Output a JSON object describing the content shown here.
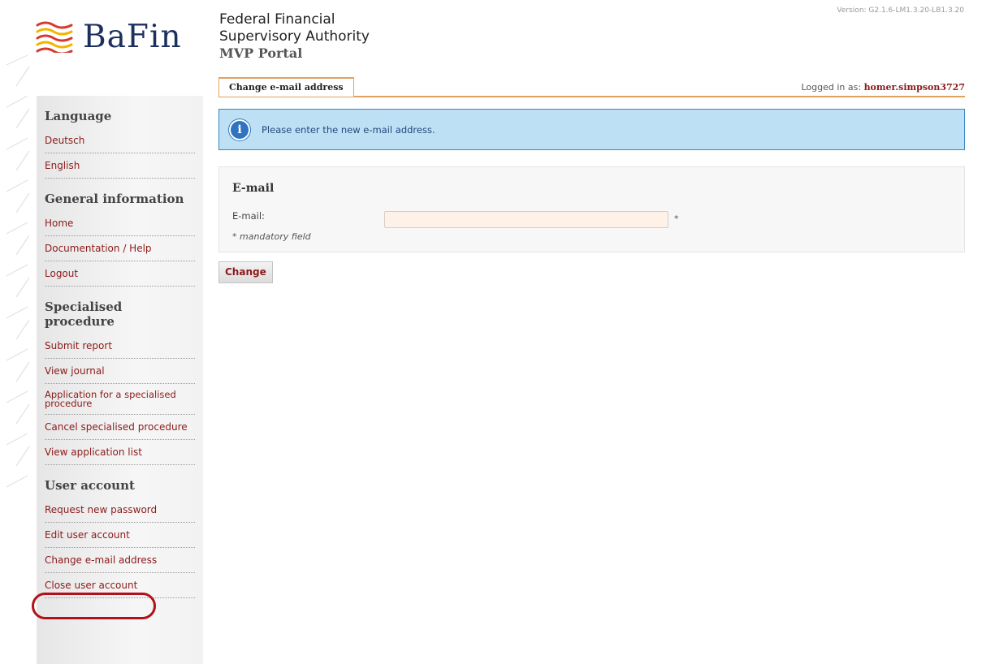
{
  "header": {
    "logo_text": "BaFin",
    "authority_line1": "Federal Financial",
    "authority_line2": "Supervisory Authority",
    "portal_name": "MVP Portal",
    "version": "Version: G2.1.6-LM1.3.20-LB1.3.20"
  },
  "tabs": {
    "active_label": "Change e-mail address",
    "logged_in_label": "Logged in as:",
    "username": "homer.simpson3727"
  },
  "sidebar": {
    "sections": [
      {
        "title": "Language",
        "items": [
          "Deutsch",
          "English"
        ]
      },
      {
        "title": "General information",
        "items": [
          "Home",
          "Documentation / Help",
          "Logout"
        ]
      },
      {
        "title": "Specialised procedure",
        "items": [
          "Submit report",
          "View journal",
          "Application for a specialised procedure",
          "Cancel specialised procedure",
          "View application list"
        ]
      },
      {
        "title": "User account",
        "items": [
          "Request new password",
          "Edit user account",
          "Change e-mail address",
          "Close user account"
        ]
      }
    ]
  },
  "info": {
    "icon": "info-icon",
    "message": "Please enter the new e-mail address."
  },
  "form": {
    "title": "E-mail",
    "email_label": "E-mail:",
    "email_value": "",
    "required_mark": "*",
    "mandatory_note": "* mandatory field"
  },
  "actions": {
    "change_label": "Change"
  },
  "colors": {
    "brand_navy": "#1c2f5e",
    "link_red": "#8b1a1a",
    "tab_orange": "#e0a060",
    "info_bg": "#bde0f4",
    "highlight_red": "#b0111a"
  }
}
